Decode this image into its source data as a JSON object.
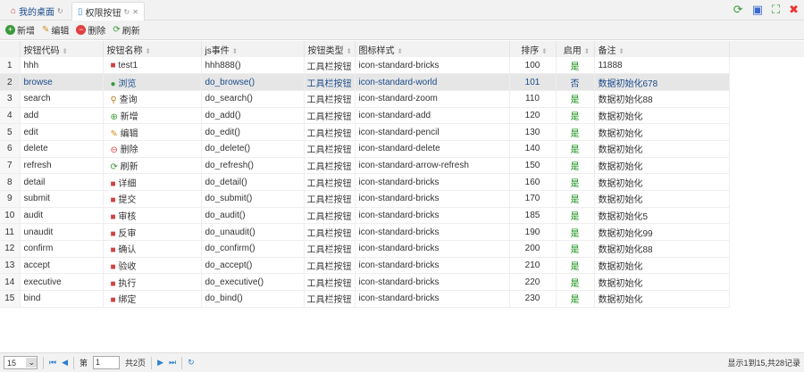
{
  "tabs": [
    {
      "label": "我的桌面",
      "icon": "home-icon"
    },
    {
      "label": "权限按钮",
      "icon": "document-icon",
      "active": true
    }
  ],
  "toolbar": {
    "add": "新增",
    "edit": "编辑",
    "delete": "删除",
    "refresh": "刷新"
  },
  "columns": [
    "按钮代码",
    "按钮名称",
    "js事件",
    "按钮类型",
    "图标样式",
    "排序",
    "启用",
    "备注"
  ],
  "rows": [
    {
      "n": "1",
      "code": "hhh",
      "name": "test1",
      "js": "hhh888()",
      "type": "工具栏按钮",
      "icon": "icon-standard-bricks",
      "sort": "100",
      "enabled": "是",
      "remark": "11888"
    },
    {
      "n": "2",
      "code": "browse",
      "name": "浏览",
      "js": "do_browse()",
      "type": "工具栏按钮",
      "icon": "icon-standard-world",
      "sort": "101",
      "enabled": "否",
      "remark": "数据初始化678"
    },
    {
      "n": "3",
      "code": "search",
      "name": "查询",
      "js": "do_search()",
      "type": "工具栏按钮",
      "icon": "icon-standard-zoom",
      "sort": "110",
      "enabled": "是",
      "remark": "数据初始化88"
    },
    {
      "n": "4",
      "code": "add",
      "name": "新增",
      "js": "do_add()",
      "type": "工具栏按钮",
      "icon": "icon-standard-add",
      "sort": "120",
      "enabled": "是",
      "remark": "数据初始化"
    },
    {
      "n": "5",
      "code": "edit",
      "name": "编辑",
      "js": "do_edit()",
      "type": "工具栏按钮",
      "icon": "icon-standard-pencil",
      "sort": "130",
      "enabled": "是",
      "remark": "数据初始化"
    },
    {
      "n": "6",
      "code": "delete",
      "name": "删除",
      "js": "do_delete()",
      "type": "工具栏按钮",
      "icon": "icon-standard-delete",
      "sort": "140",
      "enabled": "是",
      "remark": "数据初始化"
    },
    {
      "n": "7",
      "code": "refresh",
      "name": "刷新",
      "js": "do_refresh()",
      "type": "工具栏按钮",
      "icon": "icon-standard-arrow-refresh",
      "sort": "150",
      "enabled": "是",
      "remark": "数据初始化"
    },
    {
      "n": "8",
      "code": "detail",
      "name": "详细",
      "js": "do_detail()",
      "type": "工具栏按钮",
      "icon": "icon-standard-bricks",
      "sort": "160",
      "enabled": "是",
      "remark": "数据初始化"
    },
    {
      "n": "9",
      "code": "submit",
      "name": "提交",
      "js": "do_submit()",
      "type": "工具栏按钮",
      "icon": "icon-standard-bricks",
      "sort": "170",
      "enabled": "是",
      "remark": "数据初始化"
    },
    {
      "n": "10",
      "code": "audit",
      "name": "审核",
      "js": "do_audit()",
      "type": "工具栏按钮",
      "icon": "icon-standard-bricks",
      "sort": "185",
      "enabled": "是",
      "remark": "数据初始化5"
    },
    {
      "n": "11",
      "code": "unaudit",
      "name": "反审",
      "js": "do_unaudit()",
      "type": "工具栏按钮",
      "icon": "icon-standard-bricks",
      "sort": "190",
      "enabled": "是",
      "remark": "数据初始化99"
    },
    {
      "n": "12",
      "code": "confirm",
      "name": "确认",
      "js": "do_confirm()",
      "type": "工具栏按钮",
      "icon": "icon-standard-bricks",
      "sort": "200",
      "enabled": "是",
      "remark": "数据初始化88"
    },
    {
      "n": "13",
      "code": "accept",
      "name": "验收",
      "js": "do_accept()",
      "type": "工具栏按钮",
      "icon": "icon-standard-bricks",
      "sort": "210",
      "enabled": "是",
      "remark": "数据初始化"
    },
    {
      "n": "14",
      "code": "executive",
      "name": "执行",
      "js": "do_executive()",
      "type": "工具栏按钮",
      "icon": "icon-standard-bricks",
      "sort": "220",
      "enabled": "是",
      "remark": "数据初始化"
    },
    {
      "n": "15",
      "code": "bind",
      "name": "绑定",
      "js": "do_bind()",
      "type": "工具栏按钮",
      "icon": "icon-standard-bricks",
      "sort": "230",
      "enabled": "是",
      "remark": "数据初始化"
    }
  ],
  "pager": {
    "page_size": "15",
    "page_prefix": "第",
    "page": "1",
    "total_pages": "共2页",
    "info": "显示1到15,共28记录"
  }
}
